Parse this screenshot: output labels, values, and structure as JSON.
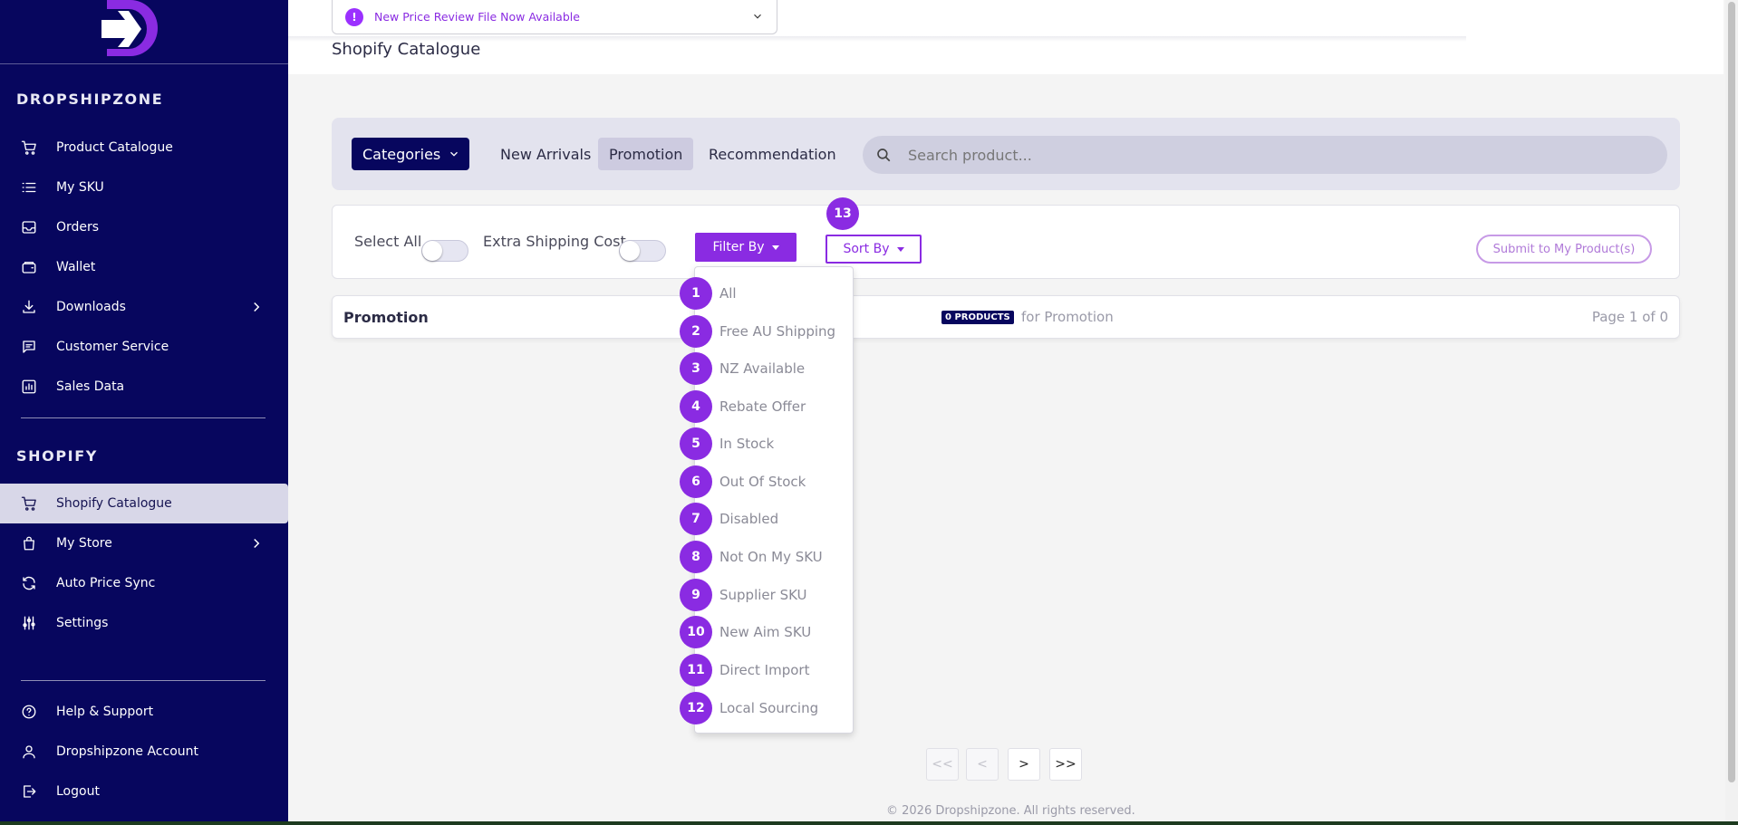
{
  "sidebar": {
    "brand_section": "DROPSHIPZONE",
    "shopify_section": "SHOPIFY",
    "items": [
      {
        "label": "Product Catalogue",
        "icon": "cart-icon"
      },
      {
        "label": "My SKU",
        "icon": "list-icon"
      },
      {
        "label": "Orders",
        "icon": "inbox-icon"
      },
      {
        "label": "Wallet",
        "icon": "wallet-icon"
      },
      {
        "label": "Downloads",
        "icon": "download-icon"
      },
      {
        "label": "Customer Service",
        "icon": "chat-icon"
      },
      {
        "label": "Sales Data",
        "icon": "chart-icon"
      }
    ],
    "shopify_items": [
      {
        "label": "Shopify Catalogue",
        "icon": "cart-icon"
      },
      {
        "label": "My Store",
        "icon": "bag-icon"
      },
      {
        "label": "Auto Price Sync",
        "icon": "sync-icon"
      },
      {
        "label": "Settings",
        "icon": "sliders-icon"
      }
    ],
    "bottom_items": [
      {
        "label": "Help & Support",
        "icon": "help-icon"
      },
      {
        "label": "Dropshipzone Account",
        "icon": "user-icon"
      },
      {
        "label": "Logout",
        "icon": "logout-icon"
      }
    ]
  },
  "notice": {
    "text": "New Price Review File Now Available",
    "icon_glyph": "!"
  },
  "page": {
    "title": "Shopify Catalogue"
  },
  "toolbar": {
    "categories_label": "Categories",
    "tabs": [
      "New Arrivals",
      "Promotion",
      "Recommendation"
    ],
    "active_tab": "Promotion",
    "search_placeholder": "Search product..."
  },
  "filters": {
    "select_all_label": "Select All",
    "extra_shipping_label": "Extra Shipping Cost",
    "filter_by_label": "Filter By",
    "sort_by_label": "Sort By",
    "sort_badge": "13",
    "submit_label": "Submit to My Product(s)"
  },
  "result": {
    "title": "Promotion",
    "badge": "0 PRODUCTS",
    "for_text": "for Promotion",
    "page_text": "Page 1 of 0"
  },
  "dropdown_options": [
    {
      "num": "1",
      "label": "All"
    },
    {
      "num": "2",
      "label": "Free AU Shipping"
    },
    {
      "num": "3",
      "label": "NZ Available"
    },
    {
      "num": "4",
      "label": "Rebate Offer"
    },
    {
      "num": "5",
      "label": "In Stock"
    },
    {
      "num": "6",
      "label": "Out Of Stock"
    },
    {
      "num": "7",
      "label": "Disabled"
    },
    {
      "num": "8",
      "label": "Not On My SKU"
    },
    {
      "num": "9",
      "label": "Supplier SKU"
    },
    {
      "num": "10",
      "label": "New Aim SKU"
    },
    {
      "num": "11",
      "label": "Direct Import"
    },
    {
      "num": "12",
      "label": "Local Sourcing"
    }
  ],
  "pagination": {
    "first": "<<",
    "prev": "<",
    "next": ">",
    "last": ">>"
  },
  "footer": {
    "text": "© 2026 Dropshipzone. All rights reserved."
  },
  "colors": {
    "sidebar": "#07065e",
    "accent": "#8a2be2",
    "active_nav": "#d8d7e8"
  }
}
